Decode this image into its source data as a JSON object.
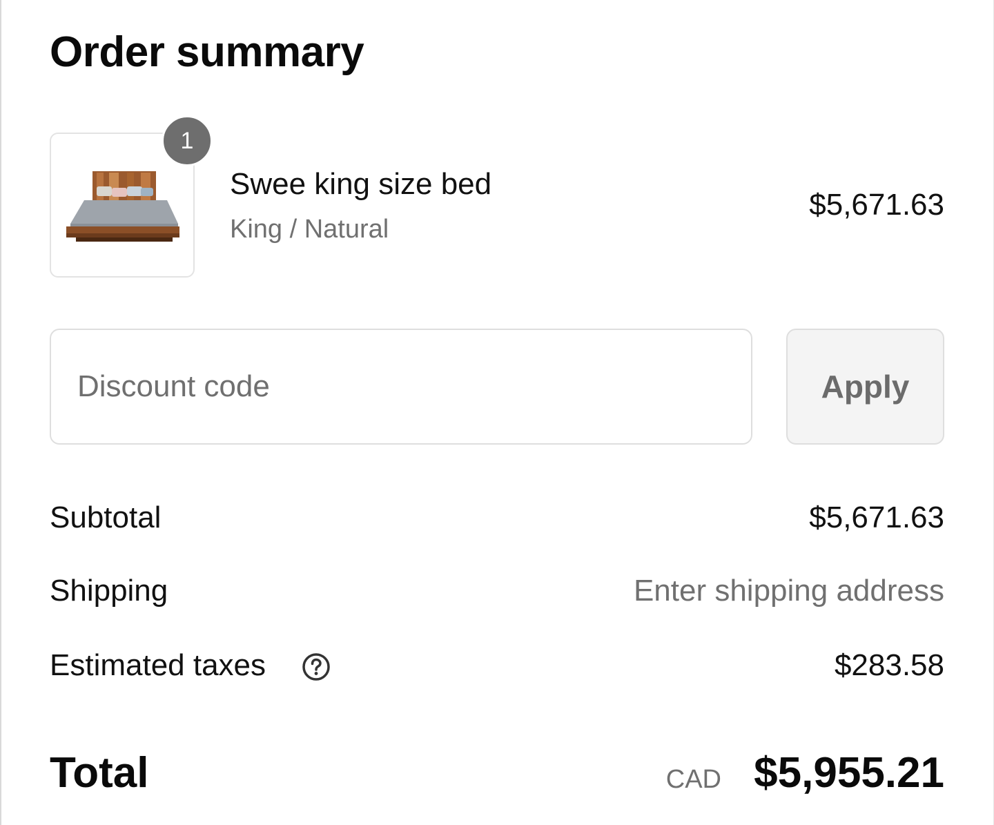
{
  "page": {
    "title": "Order summary"
  },
  "line_items": [
    {
      "quantity": "1",
      "name": "Swee king size bed",
      "variant": "King / Natural",
      "price": "$5,671.63",
      "image_icon": "bed-product-image"
    }
  ],
  "discount": {
    "placeholder": "Discount code",
    "value": "",
    "apply_label": "Apply"
  },
  "summary": {
    "subtotal_label": "Subtotal",
    "subtotal_value": "$5,671.63",
    "shipping_label": "Shipping",
    "shipping_value": "Enter shipping address",
    "taxes_label": "Estimated taxes",
    "taxes_help_icon": "question-circle-icon",
    "taxes_value": "$283.58",
    "total_label": "Total",
    "total_currency": "CAD",
    "total_value": "$5,955.21"
  },
  "colors": {
    "text_primary": "#111111",
    "text_muted": "#707070",
    "border": "#dedede",
    "badge_bg": "#6e6e6e",
    "button_bg": "#f4f4f4"
  }
}
